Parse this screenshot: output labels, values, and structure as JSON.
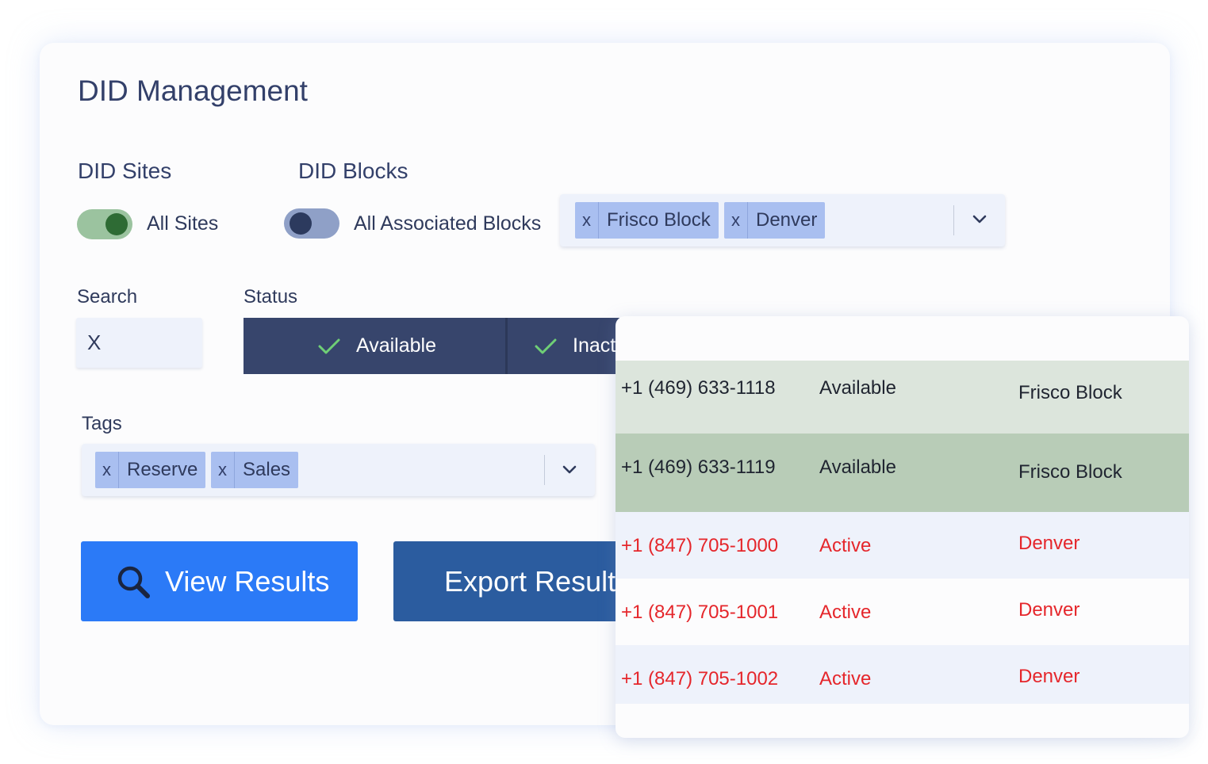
{
  "page": {
    "title": "DID Management"
  },
  "did_sites": {
    "label": "DID Sites",
    "toggle_label": "All Sites",
    "toggle_on": true
  },
  "did_blocks": {
    "label": "DID Blocks",
    "toggle_label": "All Associated Blocks",
    "toggle_on": false,
    "selected": [
      {
        "remove": "x",
        "label": "Frisco Block"
      },
      {
        "remove": "x",
        "label": "Denver"
      }
    ]
  },
  "search": {
    "label": "Search",
    "value": "X"
  },
  "status": {
    "label": "Status",
    "options": [
      {
        "label": "Available",
        "checked": true
      },
      {
        "label": "Inactive",
        "checked": true
      }
    ]
  },
  "tags": {
    "label": "Tags",
    "selected": [
      {
        "remove": "x",
        "label": "Reserve"
      },
      {
        "remove": "x",
        "label": "Sales"
      }
    ]
  },
  "actions": {
    "view_results": "View Results",
    "export_results": "Export Results"
  },
  "results": {
    "rows": [
      {
        "number": "+1 (469) 633-1118",
        "status": "Available",
        "block": "Frisco Block"
      },
      {
        "number": "+1 (469) 633-1119",
        "status": "Available",
        "block": "Frisco Block"
      },
      {
        "number": "+1 (847) 705-1000",
        "status": "Active",
        "block": "Denver"
      },
      {
        "number": "+1 (847) 705-1001",
        "status": "Active",
        "block": "Denver"
      },
      {
        "number": "+1 (847) 705-1002",
        "status": "Active",
        "block": "Denver"
      }
    ]
  },
  "colors": {
    "accent": "#2b7af7",
    "dark_navy": "#37456c",
    "export_blue": "#2b5c9f",
    "chip": "#a9bff0",
    "available_row": "#dce5dc",
    "available_row_selected": "#b8ccb7",
    "active_text": "#e5262b",
    "check": "#6fcf76"
  },
  "icons": [
    "chevron-down-icon",
    "check-icon",
    "search-icon",
    "download-icon"
  ]
}
